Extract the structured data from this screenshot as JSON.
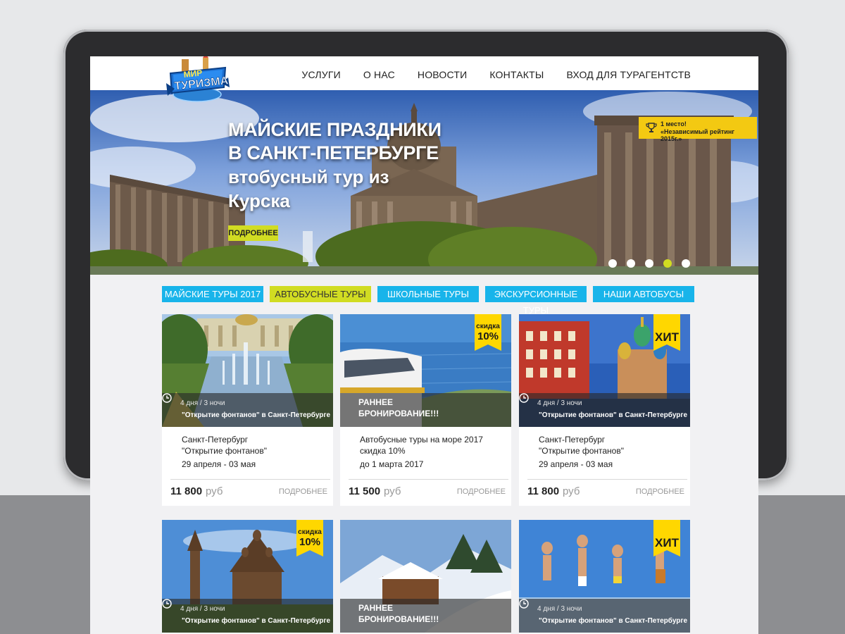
{
  "brand": {
    "logo_line1": "МИР",
    "logo_line2": "ТУРИЗМА"
  },
  "nav": [
    "УСЛУГИ",
    "О НАС",
    "НОВОСТИ",
    "КОНТАКТЫ",
    "ВХОД ДЛЯ ТУРАГЕНТСТВ"
  ],
  "hero": {
    "title_line1": "МАЙСКИЕ ПРАЗДНИКИ",
    "title_line2": "В САНКТ-ПЕТЕРБУРГЕ",
    "subtitle_line1": "втобусный тур из",
    "subtitle_line2": "Курска",
    "button": "ПОДРОБНЕЕ",
    "award_line1": "1 место!",
    "award_line2": "«Независимый рейтинг 2015г.»",
    "slides_total": 5,
    "active_slide": 4
  },
  "tabs": [
    "МАЙСКИЕ ТУРЫ 2017",
    "АВТОБУСНЫЕ ТУРЫ",
    "ШКОЛЬНЫЕ ТУРЫ",
    "ЭКСКУРСИОННЫЕ ТУРЫ",
    "НАШИ АВТОБУСЫ"
  ],
  "active_tab": 1,
  "cards": [
    {
      "duration": "4 дня / 3 ночи",
      "overlay_name": "\"Открытие фонтанов\" в Санкт-Петербурге",
      "desc_line1": "Санкт-Петербург",
      "desc_line2": "\"Открытие фонтанов\"",
      "date": "29 апреля - 03 мая",
      "price": "11 800",
      "currency": "руб",
      "more": "ПОДРОБНЕЕ"
    },
    {
      "early_line1": "РАННЕЕ",
      "early_line2": "БРОНИРОВАНИЕ!!!",
      "ribbon_small": "скидка",
      "ribbon_big": "10%",
      "desc_line1": "Автобусные туры на море 2017",
      "desc_line2": "скидка 10%",
      "date": "до 1 марта 2017",
      "price": "11 500",
      "currency": "руб",
      "more": "ПОДРОБНЕЕ"
    },
    {
      "duration": "4 дня / 3 ночи",
      "overlay_name": "\"Открытие фонтанов\" в Санкт-Петербурге",
      "ribbon_hit": "ХИТ",
      "desc_line1": "Санкт-Петербург",
      "desc_line2": "\"Открытие фонтанов\"",
      "date": "29 апреля - 03 мая",
      "price": "11 800",
      "currency": "руб",
      "more": "ПОДРОБНЕЕ"
    },
    {
      "duration": "4 дня / 3 ночи",
      "overlay_name": "\"Открытие фонтанов\" в Санкт-Петербурге",
      "ribbon_small": "скидка",
      "ribbon_big": "10%"
    },
    {
      "early_line1": "РАННЕЕ",
      "early_line2": "БРОНИРОВАНИЕ!!!"
    },
    {
      "duration": "4 дня / 3 ночи",
      "overlay_name": "\"Открытие фонтанов\" в Санкт-Петербурге",
      "ribbon_hit": "ХИТ"
    }
  ],
  "colors": {
    "accent_lime": "#d1dc22",
    "accent_blue": "#18b4ea",
    "ribbon_yellow": "#ffd700"
  },
  "icons": [
    "clock-icon",
    "trophy-icon",
    "logo-globe-icon"
  ]
}
